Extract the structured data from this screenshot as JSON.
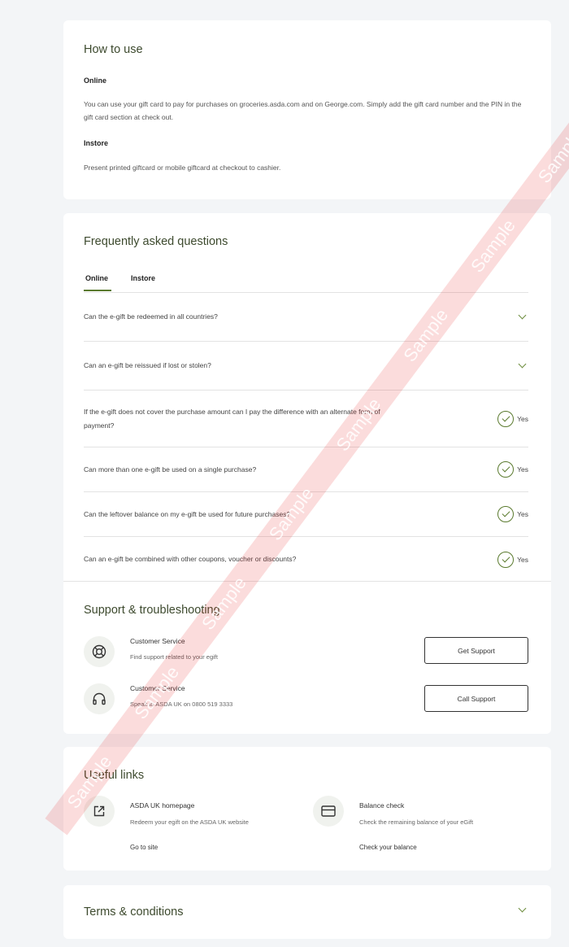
{
  "how_to_use": {
    "title": "How to use",
    "online_heading": "Online",
    "online_text": "You can use your gift card to pay for purchases on groceries.asda.com and on George.com. Simply add the gift card number and the PIN in the gift card section at check out.",
    "instore_heading": "Instore",
    "instore_text": "Present printed giftcard or mobile giftcard at checkout to cashier."
  },
  "faq": {
    "title": "Frequently asked questions",
    "tabs": [
      {
        "label": "Online",
        "active": true
      },
      {
        "label": "Instore",
        "active": false
      }
    ],
    "items": [
      {
        "question": "Can the e-gift be redeemed in all countries?",
        "answer": ""
      },
      {
        "question": "Can an e-gift be reissued if lost or stolen?",
        "answer": ""
      },
      {
        "question": "If the e-gift does not cover the purchase amount can I pay the difference with an alternate form of payment?",
        "answer": "Yes"
      },
      {
        "question": "Can more than one e-gift be used on a single purchase?",
        "answer": "Yes"
      },
      {
        "question": "Can the leftover balance on my e-gift be used for future purchases?",
        "answer": "Yes"
      },
      {
        "question": "Can an e-gift be combined with other coupons, voucher or discounts?",
        "answer": "Yes"
      }
    ]
  },
  "support": {
    "title": "Support & troubleshooting",
    "items": [
      {
        "title": "Customer Service",
        "subtitle": "Find support related to your egift",
        "button": "Get Support",
        "icon": "lifebuoy-icon"
      },
      {
        "title": "Customer Service",
        "subtitle": "Speak to ASDA UK on 0800 519 3333",
        "button": "Call Support",
        "icon": "headphones-icon"
      }
    ]
  },
  "useful_links": {
    "title": "Useful links",
    "items": [
      {
        "title": "ASDA UK homepage",
        "subtitle": "Redeem your egift on the ASDA UK website",
        "link": "Go to site",
        "icon": "external-link-icon"
      },
      {
        "title": "Balance check",
        "subtitle": "Check the remaining balance of your eGift",
        "link": "Check your balance",
        "icon": "card-icon"
      }
    ]
  },
  "terms": {
    "title": "Terms & conditions"
  },
  "watermark": {
    "words": [
      "Sample",
      "Sample",
      "Sample",
      "Sample",
      "Sample",
      "Sample",
      "Sample",
      "Sample"
    ]
  },
  "colors": {
    "accent": "#5a7a2e",
    "title": "#3d4a2e",
    "background": "#f3f5f7"
  }
}
